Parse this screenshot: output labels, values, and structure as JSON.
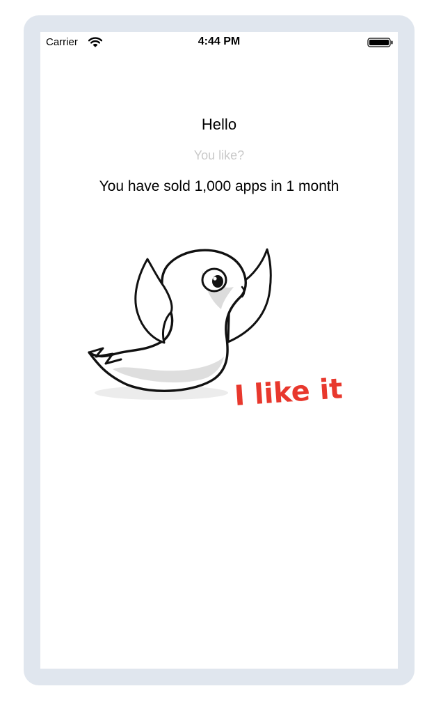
{
  "status_bar": {
    "carrier": "Carrier",
    "time": "4:44 PM",
    "wifi_icon": "wifi-icon",
    "battery_icon": "battery-full-icon"
  },
  "content": {
    "greeting": "Hello",
    "question": "You like?",
    "sales_message": "You have sold 1,000 apps in 1 month",
    "illustration": {
      "icon": "happy-bird-illustration",
      "caption": "I like it!"
    }
  },
  "colors": {
    "frame": "#e0e6ee",
    "screen": "#ffffff",
    "placeholder_text": "#c9c9c9",
    "caption_red": "#e8382d"
  }
}
